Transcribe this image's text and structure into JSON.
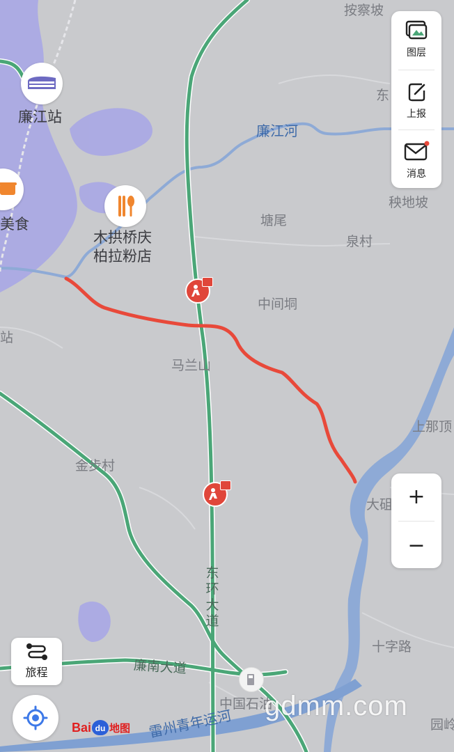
{
  "place_labels": {
    "anchapo": "按察坡",
    "dong": "东",
    "lianjiang_station": "廉江站",
    "food": "美食",
    "restaurant": "木拱桥庆\n柏拉粉店",
    "yangdipo": "秧地坡",
    "tangwei": "塘尾",
    "quancun": "泉村",
    "zhongjiandong": "中间垌",
    "zhan": "站",
    "malanshan": "马兰山",
    "shangnading": "上那顶",
    "jinbucun": "金步村",
    "dashi": "大砠",
    "shizilu": "十字路",
    "sinopec": "中国石油",
    "yuanling": "园岭"
  },
  "roads": {
    "donghuan": "东环大道",
    "liannan": "廉南大道"
  },
  "water": {
    "lianjiang_river": "廉江河",
    "canal": "雷州青年运河"
  },
  "right_panel": {
    "layers": "图层",
    "report": "上报",
    "messages": "消息"
  },
  "zoom": {
    "in": "+",
    "out": "−"
  },
  "trip": {
    "label": "旅程"
  },
  "logo": {
    "bai": "Bai",
    "du": "du",
    "map": "地图"
  },
  "watermark": "gdmm.com",
  "colors": {
    "land": "#c9cacd",
    "highway": "#4aa677",
    "river": "#8eaad6",
    "urban": "#a7a6e6",
    "route": "#e8493a"
  },
  "icons": {
    "station": "train-icon",
    "food": "food-pot-icon",
    "restaurant": "utensils-icon",
    "roadwork": "construction-icon",
    "gas": "gas-station-icon",
    "layers": "layers-icon",
    "report": "edit-icon",
    "messages": "mail-icon",
    "trip": "route-icon",
    "locate": "locate-icon"
  }
}
